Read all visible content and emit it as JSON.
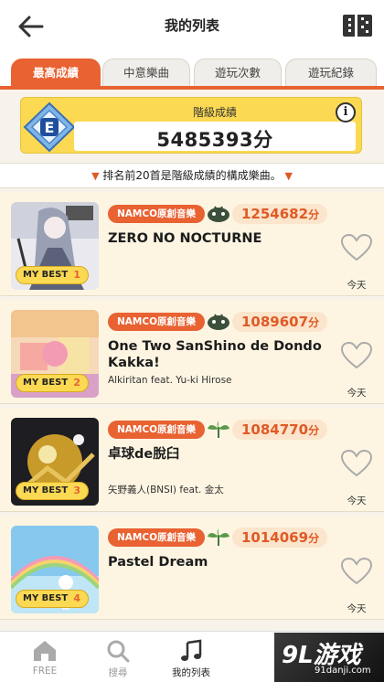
{
  "header": {
    "title": "我的列表",
    "back_icon": "arrow-left-icon",
    "menu_icon": "list-menu-icon"
  },
  "tabs": [
    {
      "label": "最高成績",
      "active": true
    },
    {
      "label": "中意樂曲",
      "active": false
    },
    {
      "label": "遊玩次數",
      "active": false
    },
    {
      "label": "遊玩紀錄",
      "active": false
    }
  ],
  "rank": {
    "grade": "E",
    "label": "階級成績",
    "score": "5485393分",
    "info": "i"
  },
  "notice": {
    "marker": "▼",
    "text": "排名前20首是階級成績的構成樂曲。"
  },
  "songs": [
    {
      "category": "NAMCO原創音樂",
      "score": "1254682",
      "unit": "分",
      "title": "ZERO NO NOCTURNE",
      "artist": "",
      "mybest_label": "MY BEST",
      "mybest_rank": "1",
      "date": "今天",
      "difficulty_icon": "oni-icon"
    },
    {
      "category": "NAMCO原創音樂",
      "score": "1089607",
      "unit": "分",
      "title": "One Two SanShino de Dondo Kakka!",
      "artist": "Alkiritan feat. Yu-ki Hirose",
      "mybest_label": "MY BEST",
      "mybest_rank": "2",
      "date": "今天",
      "difficulty_icon": "oni-icon"
    },
    {
      "category": "NAMCO原創音樂",
      "score": "1084770",
      "unit": "分",
      "title": "卓球de脫臼",
      "artist": "矢野義人(BNSI) feat. 金太",
      "mybest_label": "MY BEST",
      "mybest_rank": "3",
      "date": "今天",
      "difficulty_icon": "leaf-icon"
    },
    {
      "category": "NAMCO原創音樂",
      "score": "1014069",
      "unit": "分",
      "title": "Pastel Dream",
      "artist": "",
      "mybest_label": "MY BEST",
      "mybest_rank": "4",
      "date": "今天",
      "difficulty_icon": "leaf-icon"
    }
  ],
  "nav": [
    {
      "label": "FREE",
      "icon": "home-icon"
    },
    {
      "label": "搜尋",
      "icon": "search-icon"
    },
    {
      "label": "我的列表",
      "icon": "music-note-icon",
      "active": true
    }
  ],
  "watermark": {
    "big": "9L游戏",
    "small": "91danji.com"
  },
  "colors": {
    "accent": "#e86232",
    "gold": "#fbd953",
    "row_bg": "#fdf5e2"
  }
}
